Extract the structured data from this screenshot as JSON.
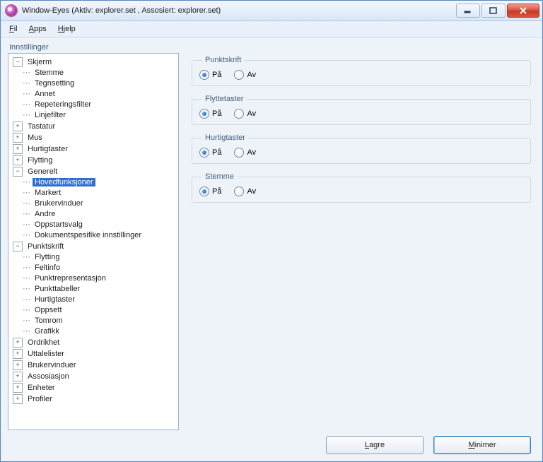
{
  "window": {
    "title": "Window-Eyes (Aktiv: explorer.set , Assosiert: explorer.set)"
  },
  "menu": {
    "file": "Fil",
    "apps": "Apps",
    "help": "Hjelp"
  },
  "panel_heading": "Innstillinger",
  "tree": [
    {
      "label": "Skjerm",
      "state": "open",
      "children": [
        {
          "label": "Stemme"
        },
        {
          "label": "Tegnsetting"
        },
        {
          "label": "Annet"
        },
        {
          "label": "Repeteringsfilter"
        },
        {
          "label": "Linjefilter"
        }
      ]
    },
    {
      "label": "Tastatur",
      "state": "closed"
    },
    {
      "label": "Mus",
      "state": "closed"
    },
    {
      "label": "Hurtigtaster",
      "state": "closed"
    },
    {
      "label": "Flytting",
      "state": "closed"
    },
    {
      "label": "Generelt",
      "state": "open",
      "children": [
        {
          "label": "Hovedfunksjoner",
          "selected": true
        },
        {
          "label": "Markert"
        },
        {
          "label": "Brukervinduer"
        },
        {
          "label": "Andre"
        },
        {
          "label": "Oppstartsvalg"
        },
        {
          "label": "Dokumentspesifike innstillinger"
        }
      ]
    },
    {
      "label": "Punktskrift",
      "state": "open",
      "children": [
        {
          "label": "Flytting"
        },
        {
          "label": "Feltinfo"
        },
        {
          "label": "Punktrepresentasjon"
        },
        {
          "label": "Punkttabeller"
        },
        {
          "label": "Hurtigtaster"
        },
        {
          "label": "Oppsett"
        },
        {
          "label": "Tomrom"
        },
        {
          "label": "Grafikk"
        }
      ]
    },
    {
      "label": "Ordrikhet",
      "state": "closed"
    },
    {
      "label": "Uttalelister",
      "state": "closed"
    },
    {
      "label": "Brukervinduer",
      "state": "closed"
    },
    {
      "label": "Assosiasjon",
      "state": "closed"
    },
    {
      "label": "Enheter",
      "state": "closed"
    },
    {
      "label": "Profiler",
      "state": "closed"
    }
  ],
  "options": {
    "on_label": "På",
    "off_label": "Av",
    "groups": [
      {
        "name": "punktskrift",
        "title": "Punktskrift",
        "value": "on"
      },
      {
        "name": "flyttetaster",
        "title": "Flyttetaster",
        "value": "on"
      },
      {
        "name": "hurtigtaster",
        "title": "Hurtigtaster",
        "value": "on"
      },
      {
        "name": "stemme",
        "title": "Stemme",
        "value": "on"
      }
    ]
  },
  "buttons": {
    "save": "Lagre",
    "minimize": "Minimer"
  }
}
